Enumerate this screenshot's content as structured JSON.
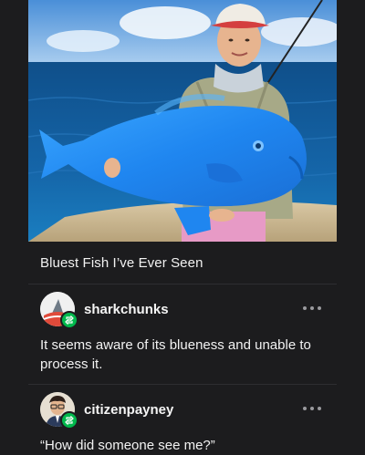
{
  "post": {
    "caption": "Bluest Fish I’ve Ever Seen"
  },
  "comments": [
    {
      "username": "sharkchunks",
      "text": "It seems aware of its blueness and unable to process it."
    },
    {
      "username": "citizenpayney",
      "text": "“How did someone see me?”"
    }
  ],
  "icons": {
    "reblog": "reblog-icon",
    "more": "more-options-icon"
  },
  "colors": {
    "background": "#1c1c1e",
    "reblog_badge": "#00b84c",
    "text": "#f2f2f2",
    "muted": "#9a9a9e"
  }
}
